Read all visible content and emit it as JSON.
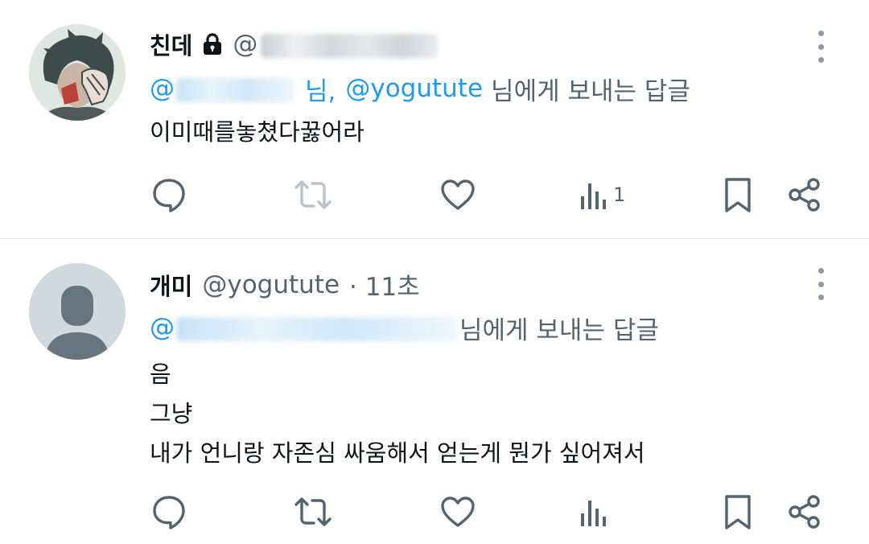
{
  "tweets": [
    {
      "display_name": "친데",
      "handle_prefix": "@",
      "protected_icon": "lock-icon",
      "reply_prefix": "@",
      "reply_middle": "님,",
      "reply_mention": "@yogutute",
      "reply_suffix": "님에게 보내는 답글",
      "lines": [
        "이미때를놓쳤다꿇어라"
      ],
      "views": "1",
      "actions": [
        "reply-icon",
        "retweet-icon",
        "like-icon",
        "views-icon",
        "bookmark-icon",
        "share-icon"
      ]
    },
    {
      "display_name": "개미",
      "handle": "@yogutute",
      "time": "· 11초",
      "reply_prefix": "@",
      "reply_suffix": "님에게 보내는 답글",
      "lines": [
        "음",
        "그냥",
        "내가 언니랑 자존심 싸움해서 얻는게 뭔가 싶어져서"
      ],
      "views": "",
      "actions": [
        "reply-icon",
        "retweet-icon",
        "like-icon",
        "views-icon",
        "bookmark-icon",
        "share-icon"
      ]
    }
  ],
  "colors": {
    "text": "#0f1419",
    "secondary": "#536471",
    "mention": "#1d9bf0",
    "icon": "#536471",
    "retweet_disabled": "#b9c3cb",
    "divider": "#e1e6ea"
  }
}
